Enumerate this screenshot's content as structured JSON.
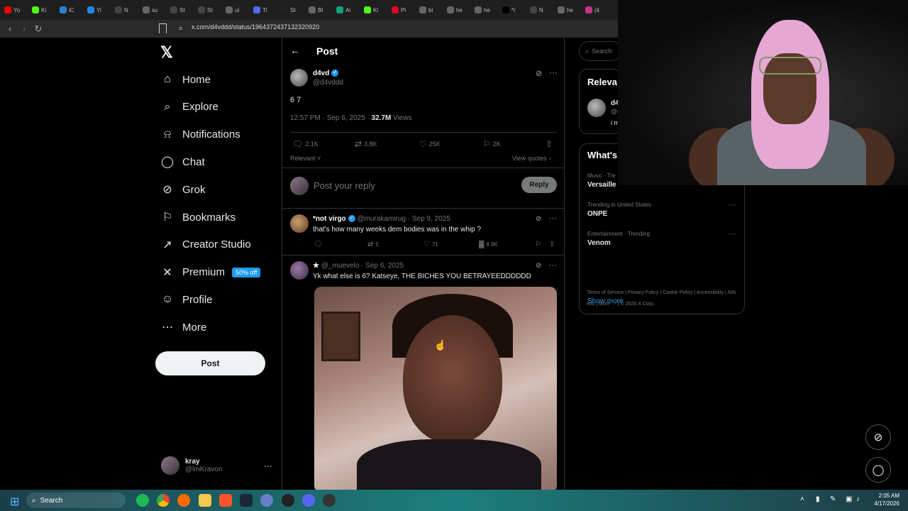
{
  "browser": {
    "tabs": [
      {
        "label": "Yo",
        "color": "#ff0000"
      },
      {
        "label": "Ki",
        "color": "#53fc18"
      },
      {
        "label": "iC",
        "color": "#2a7fd4"
      },
      {
        "label": "Yi",
        "color": "#1e88e5"
      },
      {
        "label": "N",
        "color": "#444444"
      },
      {
        "label": "su",
        "color": "#666666"
      },
      {
        "label": "St",
        "color": "#444444"
      },
      {
        "label": "St",
        "color": "#444444"
      },
      {
        "label": "ui",
        "color": "#666666"
      },
      {
        "label": "Tl",
        "color": "#4a6cf7"
      },
      {
        "label": "St",
        "color": "#222222"
      },
      {
        "label": "Bl",
        "color": "#666666"
      },
      {
        "label": "Ai",
        "color": "#10a37f"
      },
      {
        "label": "Ki",
        "color": "#53fc18"
      },
      {
        "label": "Pi",
        "color": "#e60023"
      },
      {
        "label": "bi",
        "color": "#666666"
      },
      {
        "label": "he",
        "color": "#666666"
      },
      {
        "label": "he",
        "color": "#666666"
      },
      {
        "label": "*r",
        "color": "#000000"
      },
      {
        "label": "N",
        "color": "#444444"
      },
      {
        "label": "he",
        "color": "#666666"
      },
      {
        "label": "(4",
        "color": "#c13584"
      }
    ],
    "url": "x.com/d4vddd/status/1964372437132320920"
  },
  "nav": {
    "items": [
      {
        "label": "Home",
        "icon": "home-icon"
      },
      {
        "label": "Explore",
        "icon": "search-icon"
      },
      {
        "label": "Notifications",
        "icon": "bell-icon"
      },
      {
        "label": "Chat",
        "icon": "chat-icon"
      },
      {
        "label": "Grok",
        "icon": "grok-icon"
      },
      {
        "label": "Bookmarks",
        "icon": "bookmark-icon"
      },
      {
        "label": "Creator Studio",
        "icon": "rocket-icon"
      },
      {
        "label": "Premium",
        "icon": "x-icon"
      },
      {
        "label": "Profile",
        "icon": "person-icon"
      },
      {
        "label": "More",
        "icon": "more-circle-icon"
      }
    ],
    "premium_badge": "50% off",
    "post_button": "Post",
    "account": {
      "name": "kray",
      "handle": "@lmKravon"
    }
  },
  "post": {
    "header_title": "Post",
    "author_name": "d4vd",
    "author_handle": "@d4vddd",
    "text": "6 7",
    "time": "12:57 PM · Sep 6, 2025 · ",
    "views_count": "32.7M",
    "views_label": " Views",
    "stats": {
      "replies": "2.1K",
      "reposts": "3.8K",
      "likes": "25K",
      "bookmarks": "2K"
    },
    "sort_label": "Relevant",
    "view_quotes": "View quotes",
    "reply_placeholder": "Post your reply",
    "reply_button": "Reply"
  },
  "comments": [
    {
      "name": "*not virgo",
      "handle": "@murakamirug · Sep 9, 2025",
      "text": "that's how many weeks dem bodies was in the whip ?",
      "replies": "",
      "reposts": "1",
      "likes": "71",
      "views": "8.9K"
    },
    {
      "name": "★",
      "handle": "@_muevelo · Sep 6, 2025",
      "text": "Yk what else is 6? Katseye, THE BICHES YOU BETRAYEEDDDDDD"
    }
  ],
  "right": {
    "search_placeholder": "Search",
    "relevant_title": "Releva",
    "relevant_name": "d4",
    "relevant_handle": "@c",
    "relevant_bio": "i m",
    "trends_title": "What's",
    "trends": [
      {
        "category": "Music · Tre",
        "name": "Versaille"
      },
      {
        "category": "Trending in United States",
        "name": "ONPE"
      },
      {
        "category": "Entertainment · Trending",
        "name": "Venom"
      }
    ],
    "show_more": "Show more",
    "footer": [
      "Terms of Service",
      "Privacy Policy",
      "Cookie Policy",
      "Accessibility",
      "Ads info",
      "More ···",
      "© 2026 X Corp."
    ]
  },
  "taskbar": {
    "search_label": "Search",
    "time": "2:05 AM",
    "date": "4/17/2026"
  }
}
